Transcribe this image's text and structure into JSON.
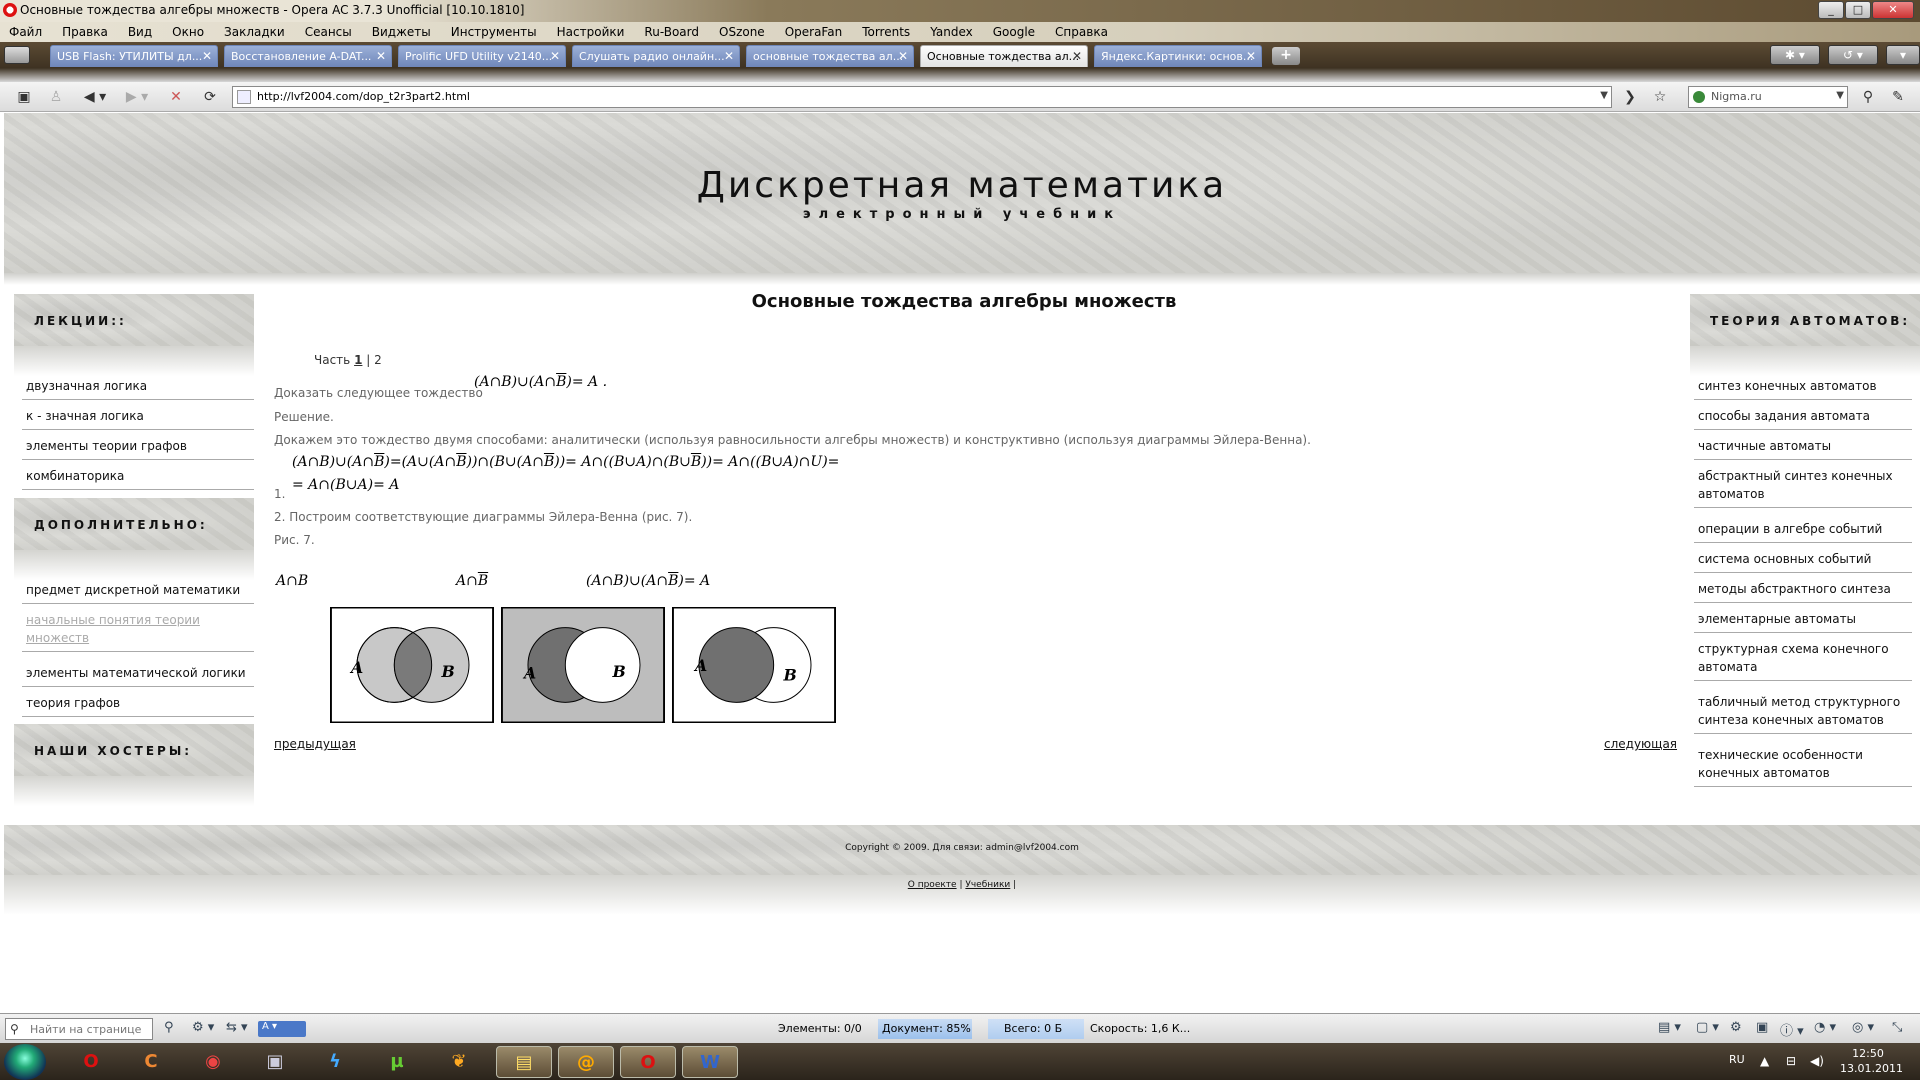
{
  "window": {
    "title": "Основные тождества алгебры множеств - Opera AC 3.7.3 Unofficial [10.10.1810]"
  },
  "menu": [
    "Файл",
    "Правка",
    "Вид",
    "Окно",
    "Закладки",
    "Сеансы",
    "Виджеты",
    "Инструменты",
    "Настройки",
    "Ru-Board",
    "OSzone",
    "OperaFan",
    "Torrents",
    "Yandex",
    "Google",
    "Справка"
  ],
  "tabs": [
    {
      "label": "USB Flash: УТИЛИТЫ дл..."
    },
    {
      "label": "Восстановление A-DAT..."
    },
    {
      "label": "Prolific UFD Utility v2140..."
    },
    {
      "label": "Слушать радио онлайн..."
    },
    {
      "label": "основные тождества ал..."
    },
    {
      "label": "Основные тождества ал..."
    },
    {
      "label": "Яндекс.Картинки: основ..."
    }
  ],
  "active_tab_index": 5,
  "address": {
    "url": "http://lvf2004.com/dop_t2r3part2.html",
    "search_engine": "Nigma.ru"
  },
  "site": {
    "title": "Дискретная математика",
    "subtitle": "электронный учебник"
  },
  "left_sidebar": {
    "lectures_heading": "ЛЕКЦИИ::",
    "lectures": [
      "двузначная логика",
      "к - значная логика",
      "элементы теории графов",
      "комбинаторика"
    ],
    "extra_heading": "ДОПОЛНИТЕЛЬНО:",
    "extra": [
      {
        "label": "предмет дискретной математики",
        "visited": false
      },
      {
        "label": "начальные понятия теории множеств",
        "visited": true
      },
      {
        "label": "элементы математической логики",
        "visited": false
      },
      {
        "label": "теория графов",
        "visited": false
      }
    ],
    "hosters_heading": "НАШИ ХОСТЕРЫ:"
  },
  "right_sidebar": {
    "heading": "ТЕОРИЯ АВТОМАТОВ:",
    "links": [
      "синтез конечных автоматов",
      "способы задания автомата",
      "частичные автоматы",
      "абстрактный синтез конечных автоматов",
      "операции в алгебре событий",
      "система основных событий",
      "методы абстрактного синтеза",
      "элементарные автоматы",
      "структурная схема конечного автомата",
      "табличный метод структурного синтеза конечных автоматов",
      "технические особенности конечных автоматов"
    ]
  },
  "content": {
    "title": "Основные тождества алгебры множеств",
    "part_label": "Часть",
    "part_current": "1",
    "part_sep": "|",
    "part_other": "2",
    "prove_text": "Доказать следующее тождество",
    "solution": "Решение.",
    "method_text": "Докажем это тождество двумя способами: аналитически (используя равносильности алгебры множеств) и конструктивно (используя диаграммы Эйлера-Венна).",
    "step1": "1.",
    "step2": "2. Построим соответствующие диаграммы Эйлера-Венна (рис. 7).",
    "fig_label": "Рис. 7.",
    "venn_labels": {
      "a": "A",
      "b": "B"
    },
    "prev": "предыдущая",
    "next": "следующая"
  },
  "footer": {
    "copyright": "Copyright © 2009. Для связи: admin@lvf2004.com",
    "about": "О проекте",
    "sep": "|",
    "books": "Учебники",
    "sep2": "|"
  },
  "statusbar": {
    "find_placeholder": "Найти на странице",
    "zoom_indicator": "A",
    "elements": "Элементы:  0/0",
    "document": "Документ:  85%",
    "document_progress": 0.85,
    "total": "Всего:  0 Б",
    "speed": "Скорость:  1,6 К..."
  },
  "taskbar": {
    "lang": "RU",
    "time": "12:50",
    "date": "13.01.2011"
  }
}
